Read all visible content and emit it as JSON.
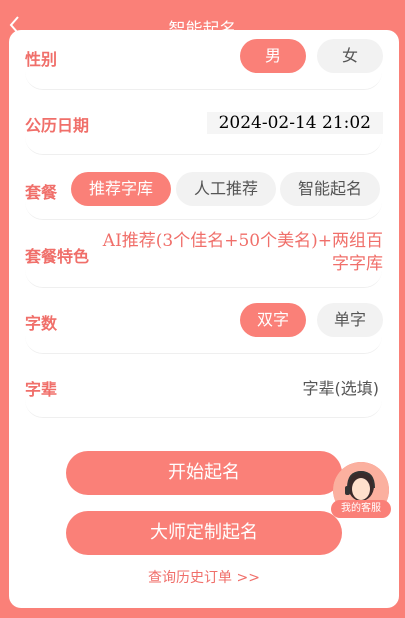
{
  "header": {
    "title": "智能起名",
    "back_icon": "chevron-left-icon"
  },
  "gender": {
    "label": "性别",
    "options": [
      "男",
      "女"
    ],
    "selected": "男"
  },
  "date": {
    "label": "公历日期",
    "value": "2024-02-14 21:02"
  },
  "package": {
    "label": "套餐",
    "options": [
      "推荐字库",
      "人工推荐",
      "智能起名"
    ],
    "selected": "推荐字库"
  },
  "feature": {
    "label": "套餐特色",
    "text": "AI推荐(3个佳名+50个美名)+两组百字字库"
  },
  "char_count": {
    "label": "字数",
    "options": [
      "双字",
      "单字"
    ],
    "selected": "双字"
  },
  "generation": {
    "label": "字辈",
    "value": "字辈(选填)"
  },
  "actions": {
    "start": "开始起名",
    "master": "大师定制起名",
    "history": "查询历史订单 >>"
  },
  "service": {
    "label": "我的客服",
    "icon": "customer-service-icon"
  },
  "colors": {
    "accent": "#fa8078",
    "accent_text": "#f06f6a"
  }
}
